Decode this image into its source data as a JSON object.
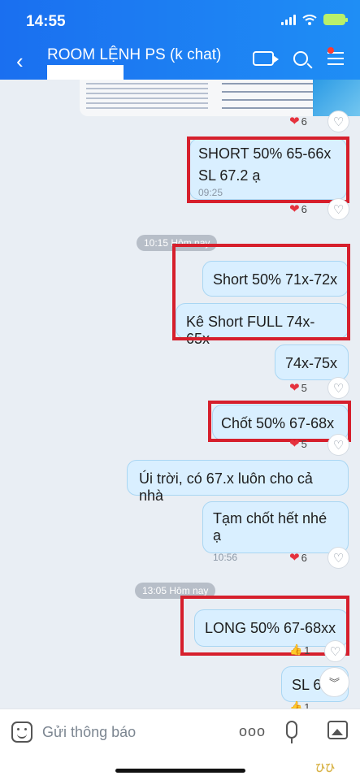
{
  "status": {
    "time": "14:55"
  },
  "header": {
    "title": "ROOM LỆNH PS (k chat)",
    "back": "‹"
  },
  "reactions": {
    "heart": "❤",
    "thumbs": "👍",
    "like": "♡",
    "r1": "6",
    "r2": "6",
    "r3": "5",
    "r4": "5",
    "r5": "6",
    "r6": "1",
    "r7": "1"
  },
  "messages": {
    "m1_line1": "SHORT 50% 65-66x",
    "m1_line2": "SL 67.2 ạ",
    "m1_time": "09:25",
    "sep1": "10:15 Hôm nay",
    "m2": "Short 50% 71x-72x",
    "m3": "Kê Short FULL 74x-65x",
    "m4": "74x-75x",
    "m5": "Chốt 50% 67-68x",
    "m6": "Úi trời, có 67.x luôn cho cả nhà",
    "m7": "Tạm chốt hết nhé ạ",
    "m7_time": "10:56",
    "sep2": "13:05 Hôm nay",
    "m8": "LONG 50% 67-68xx",
    "m9": "SL 6"
  },
  "input": {
    "placeholder": "Gửi thông báo",
    "more": "ooo"
  },
  "scroll": {
    "label": "︾"
  },
  "watermark": "ひひ"
}
